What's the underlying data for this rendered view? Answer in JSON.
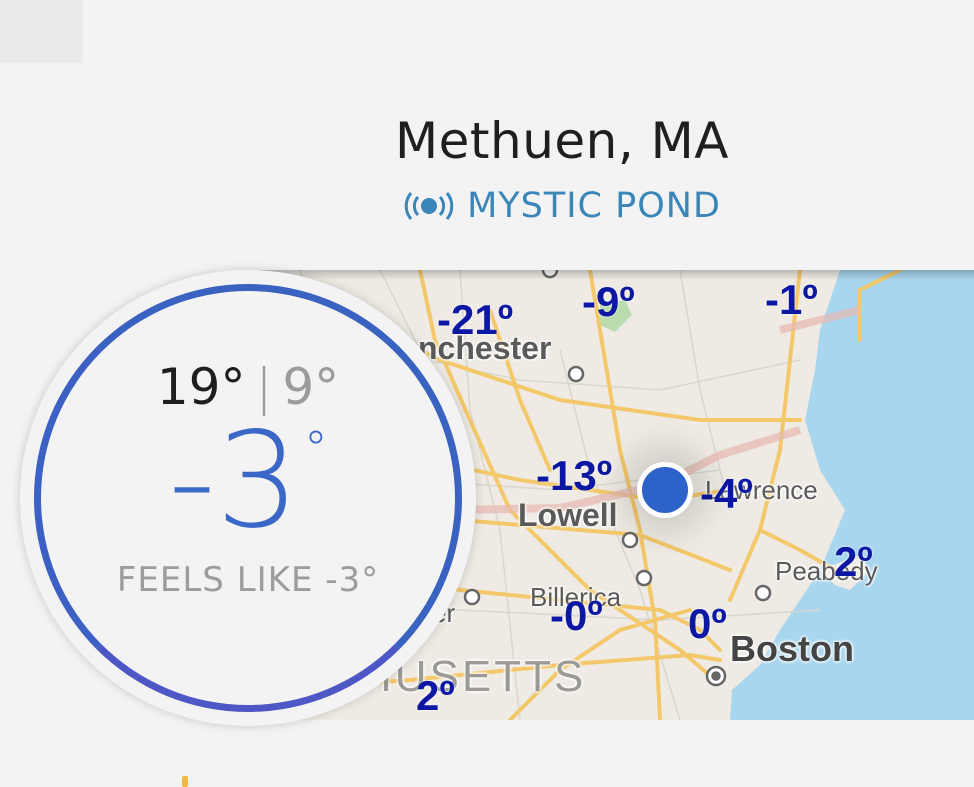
{
  "header": {
    "title": "Methuen, MA",
    "station_icon": "broadcast-signal-icon",
    "station_name": "MYSTIC POND"
  },
  "current": {
    "high": "19°",
    "separator": "|",
    "low": "9°",
    "temperature": "-3",
    "degree_symbol": "°",
    "feels_like": "FEELS LIKE -3°",
    "ring_color": "#3a62c0",
    "temp_color": "#3a67c8"
  },
  "map": {
    "place_labels": {
      "manchester": "nchester",
      "lowell": "Lowell",
      "lawrence": "Lawrence",
      "billerica": "Billerica",
      "peabody": "Peabody",
      "boston": "Boston",
      "massachusetts": "HUSETTS",
      "partial_er": "er"
    },
    "temps": {
      "t1": "-21º",
      "t2": "-9º",
      "t3": "-1º",
      "t4": "-13º",
      "t5": "-4º",
      "t6": "2º",
      "t7": "-0º",
      "t8": "0º",
      "t9": "2º"
    },
    "temp_color": "#0c17a3",
    "water_color": "#a9d6ef",
    "road_color": "#f3c86a",
    "location_dot_color": "#2d62c9"
  }
}
